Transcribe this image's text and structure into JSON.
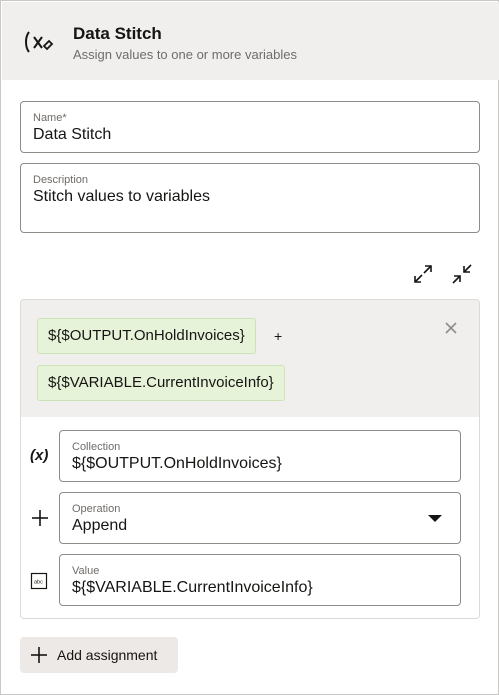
{
  "header": {
    "title": "Data Stitch",
    "subtitle": "Assign values to one or more variables",
    "icon": "variable-icon"
  },
  "form": {
    "name": {
      "label": "Name*",
      "value": "Data Stitch"
    },
    "description": {
      "label": "Description",
      "value": "Stitch values to variables"
    }
  },
  "toolbar": {
    "expand_icon": "expand-icon",
    "collapse_icon": "collapse-icon"
  },
  "assignment": {
    "chips": [
      "${$OUTPUT.OnHoldInvoices}",
      "${$VARIABLE.CurrentInvoiceInfo}"
    ],
    "plus": "+",
    "collection": {
      "icon_text": "(x)",
      "label": "Collection",
      "value": "${$OUTPUT.OnHoldInvoices}"
    },
    "operation": {
      "label": "Operation",
      "value": "Append"
    },
    "value": {
      "label": "Value",
      "value": "${$VARIABLE.CurrentInvoiceInfo}"
    }
  },
  "add_button": {
    "label": "Add assignment"
  }
}
